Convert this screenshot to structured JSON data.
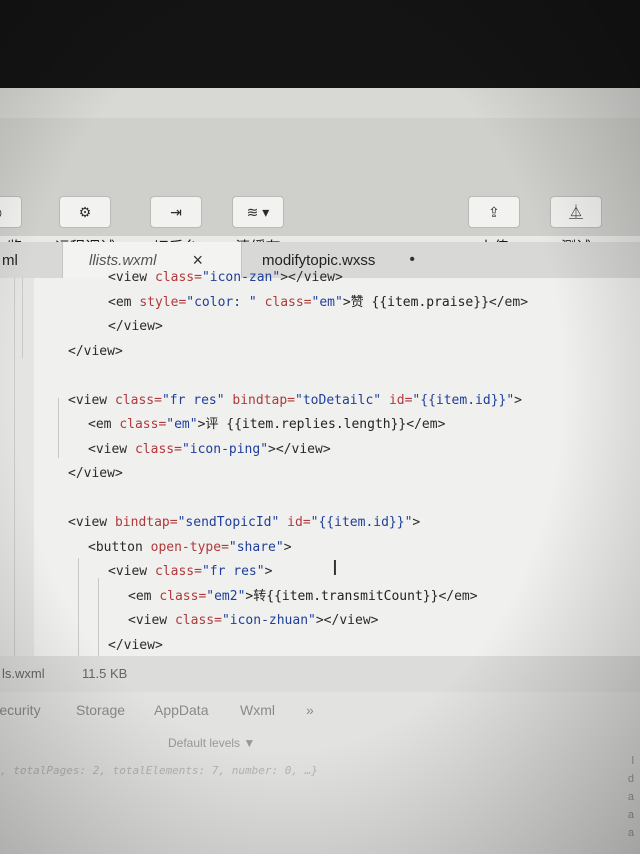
{
  "toolbar": {
    "items": [
      {
        "label": "",
        "icon": "cut-off-icon"
      },
      {
        "label": "远程调试",
        "icon": "bug-icon"
      },
      {
        "label": "切后台",
        "icon": "switch-icon"
      },
      {
        "label": "清缓存",
        "icon": "layers-icon"
      },
      {
        "label": "上传",
        "icon": "upload-icon"
      },
      {
        "label": "测试",
        "icon": "flask-icon"
      }
    ],
    "first_label_fragment": "览"
  },
  "tabs": {
    "left_fragment": "ml",
    "active": {
      "name": "llists.wxml",
      "close": "×"
    },
    "second": {
      "name": "modifytopic.wxss",
      "marker": "•"
    }
  },
  "editor": {
    "lines": [
      {
        "indent": 4,
        "parts": [
          [
            "t",
            "<view "
          ],
          [
            "a",
            "class="
          ],
          [
            "s",
            "\"icon-zan\""
          ],
          [
            "t",
            "></view>"
          ]
        ]
      },
      {
        "indent": 4,
        "parts": [
          [
            "t",
            "<em "
          ],
          [
            "a",
            "style="
          ],
          [
            "s",
            "\"color: \" "
          ],
          [
            "a",
            "class="
          ],
          [
            "s",
            "\"em\""
          ],
          [
            "x",
            ">赞 {{item.praise}}"
          ],
          [
            "t",
            "</em>"
          ]
        ]
      },
      {
        "indent": 4,
        "parts": [
          [
            "t",
            "</view>"
          ]
        ]
      },
      {
        "indent": 2,
        "parts": [
          [
            "t",
            "</view>"
          ]
        ]
      },
      {
        "indent": 0,
        "parts": []
      },
      {
        "indent": 2,
        "parts": [
          [
            "t",
            "<view "
          ],
          [
            "a",
            "class="
          ],
          [
            "s",
            "\"fr res\" "
          ],
          [
            "a",
            "bindtap="
          ],
          [
            "s",
            "\"toDetailc\" "
          ],
          [
            "a",
            "id="
          ],
          [
            "s",
            "\"{{item.id}}\""
          ],
          [
            "t",
            ">"
          ]
        ]
      },
      {
        "indent": 3,
        "parts": [
          [
            "t",
            "<em "
          ],
          [
            "a",
            "class="
          ],
          [
            "s",
            "\"em\""
          ],
          [
            "x",
            ">评 {{item.replies.length}}"
          ],
          [
            "t",
            "</em>"
          ]
        ]
      },
      {
        "indent": 3,
        "parts": [
          [
            "t",
            "<view "
          ],
          [
            "a",
            "class="
          ],
          [
            "s",
            "\"icon-ping\""
          ],
          [
            "t",
            "></view>"
          ]
        ]
      },
      {
        "indent": 2,
        "parts": [
          [
            "t",
            "</view>"
          ]
        ]
      },
      {
        "indent": 0,
        "parts": []
      },
      {
        "indent": 2,
        "parts": [
          [
            "t",
            "<view "
          ],
          [
            "a",
            "bindtap="
          ],
          [
            "s",
            "\"sendTopicId\" "
          ],
          [
            "a",
            "id="
          ],
          [
            "s",
            "\"{{item.id}}\""
          ],
          [
            "t",
            ">"
          ]
        ]
      },
      {
        "indent": 3,
        "parts": [
          [
            "t",
            "<button "
          ],
          [
            "a",
            "open-type="
          ],
          [
            "s",
            "\"share\""
          ],
          [
            "t",
            ">"
          ]
        ]
      },
      {
        "indent": 4,
        "parts": [
          [
            "t",
            "<view "
          ],
          [
            "a",
            "class="
          ],
          [
            "s",
            "\"fr res\""
          ],
          [
            "t",
            ">"
          ]
        ]
      },
      {
        "indent": 5,
        "parts": [
          [
            "t",
            "<em "
          ],
          [
            "a",
            "class="
          ],
          [
            "s",
            "\"em2\""
          ],
          [
            "x",
            ">转{{item.transmitCount}}"
          ],
          [
            "t",
            "</em>"
          ]
        ]
      },
      {
        "indent": 5,
        "parts": [
          [
            "t",
            "<view "
          ],
          [
            "a",
            "class="
          ],
          [
            "s",
            "\"icon-zhuan\""
          ],
          [
            "t",
            "></view>"
          ]
        ]
      },
      {
        "indent": 4,
        "parts": [
          [
            "t",
            "</view>"
          ]
        ]
      }
    ]
  },
  "status": {
    "file": "ls.wxml",
    "size": "11.5 KB"
  },
  "panel": {
    "tabs": [
      "Security",
      "Storage",
      "AppData",
      "Wxml",
      "»"
    ],
    "levels": "Default levels ▼",
    "console_line": ", totalPages: 2, totalElements: 7, number: 0, …}"
  }
}
